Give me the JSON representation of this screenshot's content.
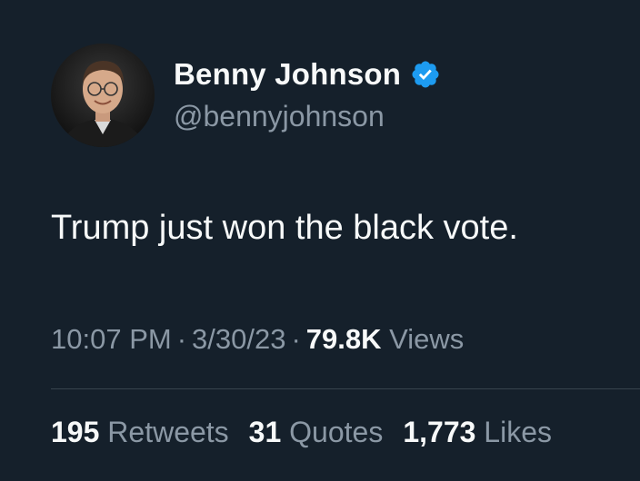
{
  "author": {
    "display_name": "Benny Johnson",
    "handle": "@bennyjohnson",
    "verified": true,
    "verified_color": "#1d9bf0"
  },
  "tweet": {
    "text": "Trump just won the black vote."
  },
  "meta": {
    "time": "10:07 PM",
    "separator": "·",
    "date": "3/30/23",
    "views_count": "79.8K",
    "views_label": "Views"
  },
  "stats": {
    "retweets_count": "195",
    "retweets_label": "Retweets",
    "quotes_count": "31",
    "quotes_label": "Quotes",
    "likes_count": "1,773",
    "likes_label": "Likes"
  },
  "icons": {
    "avatar": "profile-photo",
    "verified": "verified-badge-icon"
  },
  "colors": {
    "background": "#15202b",
    "text_primary": "#f7f9f9",
    "text_secondary": "#8b98a5",
    "divider": "#38444d"
  }
}
